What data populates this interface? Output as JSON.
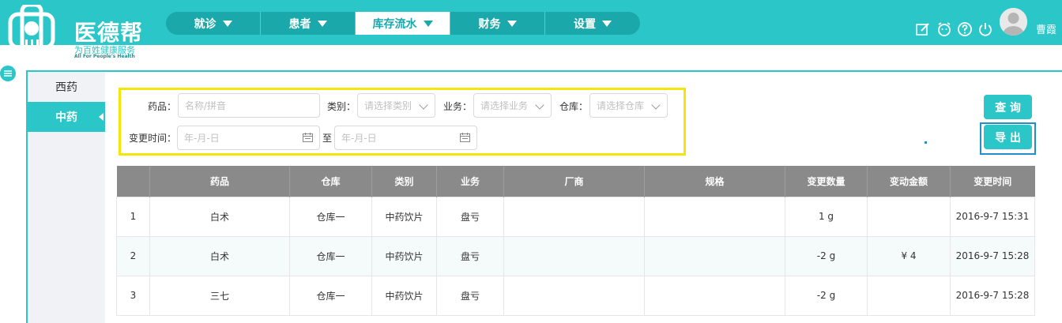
{
  "header": {
    "brand": "医德帮",
    "slogan": "为百姓健康服务",
    "slogan_en": "All For People's Health",
    "username": "曹霞",
    "nav": [
      {
        "label": "就诊",
        "active": false
      },
      {
        "label": "患者",
        "active": false
      },
      {
        "label": "库存流水",
        "active": true
      },
      {
        "label": "财务",
        "active": false
      },
      {
        "label": "设置",
        "active": false
      }
    ],
    "icons": [
      "edit-icon",
      "alarm-icon",
      "help-icon",
      "power-icon"
    ]
  },
  "left_menu": [
    {
      "label": "西药",
      "active": false
    },
    {
      "label": "中药",
      "active": true
    }
  ],
  "filter": {
    "drug_label": "药品：",
    "drug_placeholder": "名称/拼音",
    "category_label": "类别：",
    "category_placeholder": "请选择类别",
    "business_label": "业务：",
    "business_placeholder": "请选择业务",
    "warehouse_label": "仓库：",
    "warehouse_placeholder": "请选择仓库",
    "time_label": "变更时间：",
    "date_from_placeholder": "年-月-日",
    "date_sep": "至",
    "date_to_placeholder": "年-月-日"
  },
  "buttons": {
    "query": "查 询",
    "export": "导 出"
  },
  "table": {
    "headers": [
      "",
      "药品",
      "仓库",
      "类别",
      "业务",
      "厂商",
      "规格",
      "变更数量",
      "变动金额",
      "变更时间"
    ],
    "rows": [
      [
        "1",
        "白术",
        "仓库一",
        "中药饮片",
        "盘亏",
        "",
        "",
        "1 g",
        "",
        "2016-9-7 15:31"
      ],
      [
        "2",
        "白术",
        "仓库一",
        "中药饮片",
        "盘亏",
        "",
        "",
        "-2 g",
        "¥ 4",
        "2016-9-7 15:28"
      ],
      [
        "3",
        "三七",
        "仓库一",
        "中药饮片",
        "盘亏",
        "",
        "",
        "-2 g",
        "",
        "2016-9-7 15:28"
      ]
    ]
  },
  "colors": {
    "primary": "#2bc6c8",
    "nav_bg": "#1aa8aa",
    "filter_border": "#f5e60a",
    "export_frame": "#1f8fcf",
    "table_header": "#8a8a8a"
  }
}
